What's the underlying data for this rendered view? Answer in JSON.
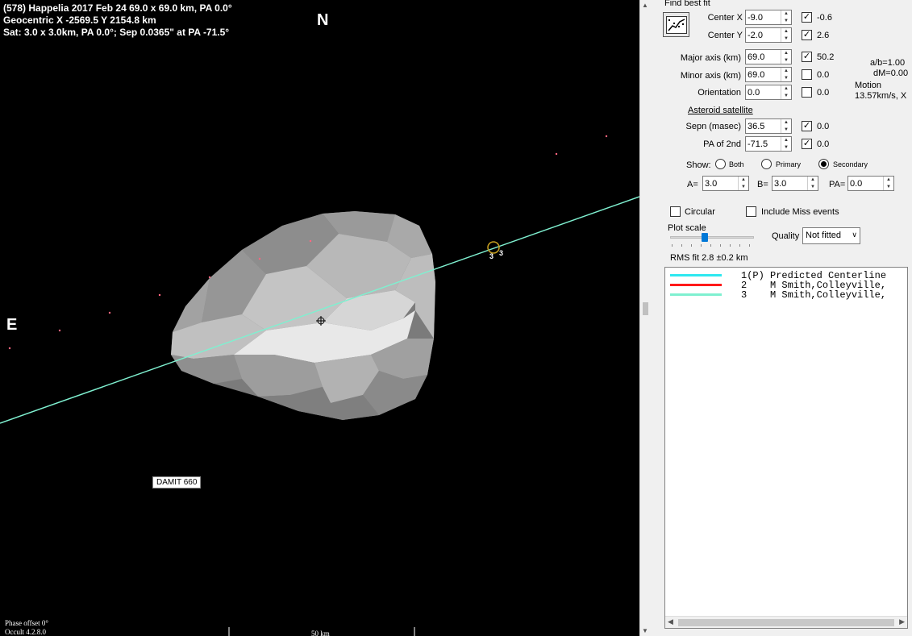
{
  "plot": {
    "header": [
      "(578) Happelia  2017 Feb 24  69.0 x 69.0 km, PA 0.0°",
      "Geocentric X  -2569.5  Y 2154.8 km",
      "Sat: 3.0 x 3.0km, PA 0.0°; Sep 0.0365\" at PA -71.5°"
    ],
    "north_label": "N",
    "east_label": "E",
    "model_label": "DAMIT 660",
    "phase_offset": "Phase offset 0°",
    "version": "Occult 4.2.8.0",
    "scale_text": "50 km",
    "chord_label_left": "3",
    "chord_label_right": "3",
    "colors": {
      "background": "#000000",
      "centerline": "#00ffff",
      "chord_red": "#ff1a1a",
      "chord_mint": "#7ff0d0",
      "satellite_marker": "#c8a020",
      "star_dots": "#ff6680"
    }
  },
  "panel": {
    "find_best_fit": "Find best fit",
    "fit_icon": "chart-fit-icon",
    "center_x": {
      "label": "Center X",
      "value": "-9.0",
      "checked": true,
      "result": "-0.6"
    },
    "center_y": {
      "label": "Center Y",
      "value": "-2.0",
      "checked": true,
      "result": "2.6"
    },
    "major_axis": {
      "label": "Major axis (km)",
      "value": "69.0",
      "checked": true,
      "result": "50.2"
    },
    "minor_axis": {
      "label": "Minor axis (km)",
      "value": "69.0",
      "checked": false,
      "result": "0.0"
    },
    "orientation": {
      "label": "Orientation",
      "value": "0.0",
      "checked": false,
      "result": "0.0"
    },
    "ab_ratio": "a/b=1.00",
    "dm": "dM=0.00",
    "motion_label": "Motion",
    "motion_value": "13.57km/s, X",
    "asteroid_satellite": "Asteroid satellite",
    "sepn": {
      "label": "Sepn (masec)",
      "value": "36.5",
      "checked": true,
      "result": "0.0"
    },
    "pa_2nd": {
      "label": "PA of 2nd",
      "value": "-71.5",
      "checked": true,
      "result": "0.0"
    },
    "show_label": "Show:",
    "show_options": [
      "Both",
      "Primary",
      "Secondary"
    ],
    "show_selected": "Secondary",
    "a_label": "A=",
    "a_value": "3.0",
    "b_label": "B=",
    "b_value": "3.0",
    "pa_label": "PA=",
    "pa_value": "0.0",
    "circular_label": "Circular",
    "include_miss_label": "Include Miss events",
    "plot_scale_label": "Plot scale",
    "plot_scale_value": 0.4,
    "quality_label": "Quality",
    "quality_value": "Not fitted",
    "rms_fit": "RMS fit 2.8 ±0.2 km",
    "legend": [
      {
        "num": "1(P)",
        "text": "Predicted Centerline",
        "color": "#2ee8f0"
      },
      {
        "num": "2",
        "text": "M Smith,Colleyville,",
        "color": "#ff1a1a"
      },
      {
        "num": "3",
        "text": "M Smith,Colleyville,",
        "color": "#7ff0d0"
      }
    ]
  }
}
